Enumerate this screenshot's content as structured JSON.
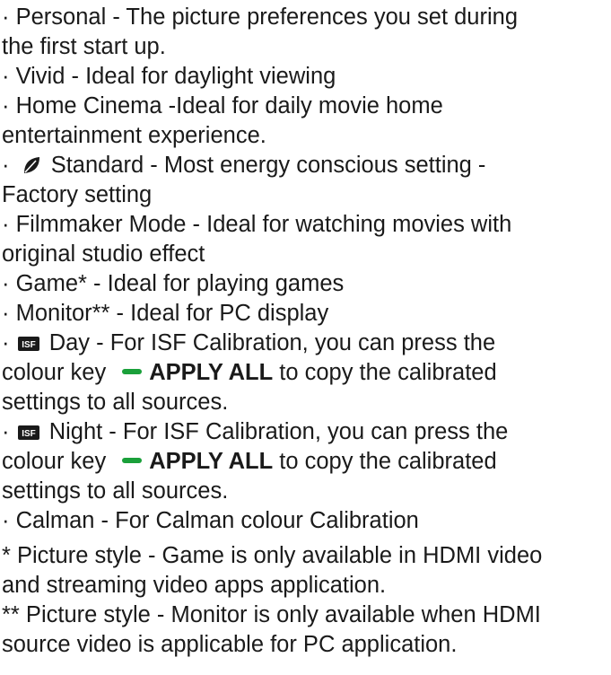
{
  "bullet": "·",
  "lines": [
    "Personal - The picture preferences you set during",
    "the first start up.",
    "Vivid - Ideal for daylight viewing",
    "Home Cinema -Ideal for daily movie home",
    "entertainment experience.",
    "Standard - Most energy conscious setting -",
    "Factory setting",
    "Filmmaker Mode - Ideal for watching movies with",
    "original studio effect",
    "Game* - Ideal for playing games",
    "Monitor** - Ideal for PC display",
    "Day - For ISF Calibration, you can press the",
    "colour key",
    "to copy the calibrated",
    "settings to all sources.",
    "Night - For ISF Calibration, you can press the",
    "colour key",
    "to copy the calibrated",
    "settings to all sources.",
    "Calman - For Calman colour Calibration"
  ],
  "apply_all_label": "APPLY ALL",
  "isf_badge_text": "ISF",
  "footnotes": [
    "* Picture style - Game is only available in HDMI video",
    "and streaming video apps application.",
    "** Picture style - Monitor is only available when HDMI",
    "source video is applicable for PC application."
  ],
  "icons": {
    "eco": "eco-leaf-icon",
    "isf": "isf-badge-icon",
    "green_key": "green-color-key-icon"
  },
  "colors": {
    "text": "#1a1a1a",
    "green_key": "#1aa03a"
  }
}
